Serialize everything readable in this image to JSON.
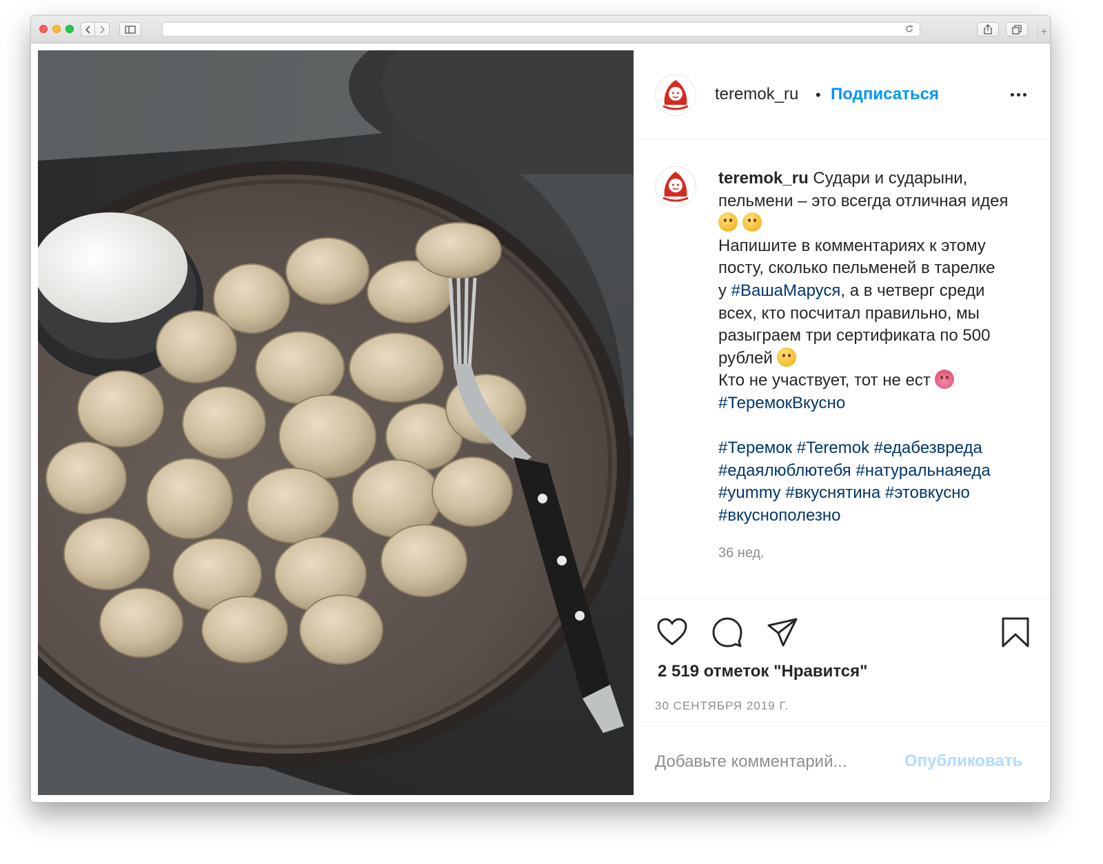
{
  "post": {
    "username": "teremok_ru",
    "separator": "•",
    "follow_label": "Подписаться",
    "caption_text": " Судари и сударыни,\nпельмени – это всегда отличная идея\n",
    "caption_part2": "\nНапишите в комментариях к этому\nпосту, сколько пельменей в тарелке\nу ",
    "hashtag_vasha": "#ВашаМаруся",
    "caption_part3": ", а в четверг среди\nвсех, кто посчитал правильно, мы\nразыграем три сертификата по 500\nрублей ",
    "caption_part4": "\nКто не участвует, тот не ест ",
    "hashtag_teremokvkusno": "#ТеремокВкусно",
    "hashtags_line1": "#Теремок #Teremok #едабезвреда",
    "hashtags_line2": "#едаялюблютебя #натуральнаяеда",
    "hashtags_line3": "#yummy #вкуснятина #этовкусно",
    "hashtags_line4": "#вкуснополезно",
    "time_ago": "36 нед.",
    "likes": "2 519 отметок \"Нравится\"",
    "date": "30 СЕНТЯБРЯ 2019 Г.",
    "comment_placeholder": "Добавьте комментарий...",
    "publish_label": "Опубликовать"
  },
  "icons": {
    "avatar": "matryoshka-logo-icon",
    "more": "more-options-icon",
    "like": "heart-icon",
    "comment": "comment-icon",
    "share": "paper-plane-icon",
    "save": "bookmark-icon"
  },
  "colors": {
    "link_blue": "#0095f6",
    "hashtag": "#00376b",
    "brand_red": "#d52b1e",
    "muted": "#8e8e8e"
  }
}
